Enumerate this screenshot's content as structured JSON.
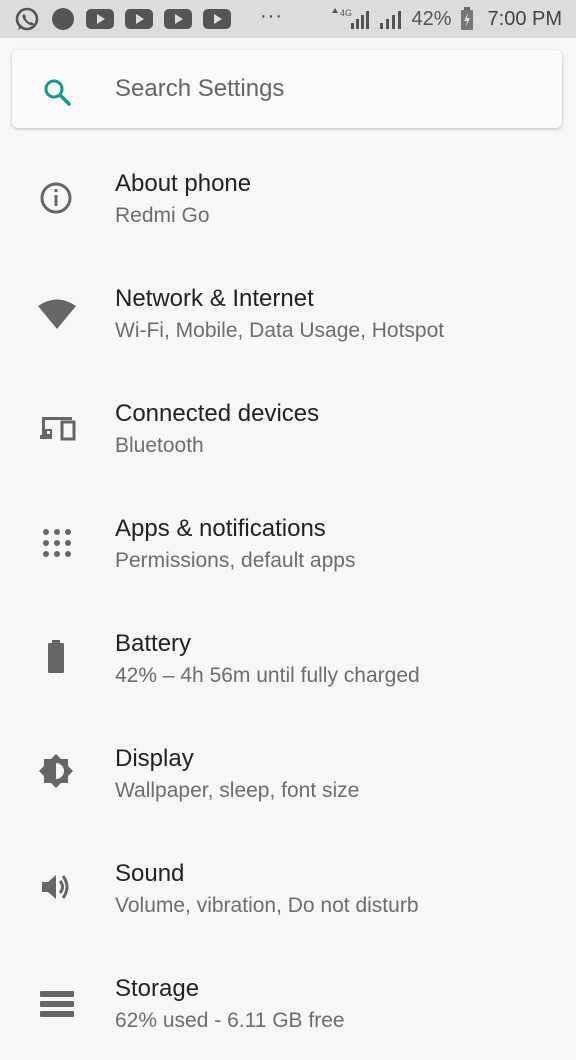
{
  "status_bar": {
    "battery_percent": "42%",
    "time": "7:00 PM",
    "more_dots": "···",
    "notification_icons": [
      "whatsapp-icon",
      "circle-notification-icon",
      "youtube-icon",
      "youtube-icon",
      "youtube-icon",
      "youtube-icon"
    ],
    "network_label": "4G"
  },
  "search": {
    "placeholder": "Search Settings",
    "accent_color": "#139a88"
  },
  "settings": [
    {
      "title": "About phone",
      "subtitle": "Redmi Go",
      "icon": "info-icon"
    },
    {
      "title": "Network & Internet",
      "subtitle": "Wi-Fi, Mobile, Data Usage, Hotspot",
      "icon": "wifi-icon"
    },
    {
      "title": "Connected devices",
      "subtitle": "Bluetooth",
      "icon": "devices-icon"
    },
    {
      "title": "Apps & notifications",
      "subtitle": "Permissions, default apps",
      "icon": "apps-grid-icon"
    },
    {
      "title": "Battery",
      "subtitle": "42% – 4h 56m until fully charged",
      "icon": "battery-icon"
    },
    {
      "title": "Display",
      "subtitle": "Wallpaper, sleep, font size",
      "icon": "brightness-icon"
    },
    {
      "title": "Sound",
      "subtitle": "Volume, vibration, Do not disturb",
      "icon": "volume-icon"
    },
    {
      "title": "Storage",
      "subtitle": "62% used - 6.11 GB free",
      "icon": "storage-icon"
    }
  ]
}
